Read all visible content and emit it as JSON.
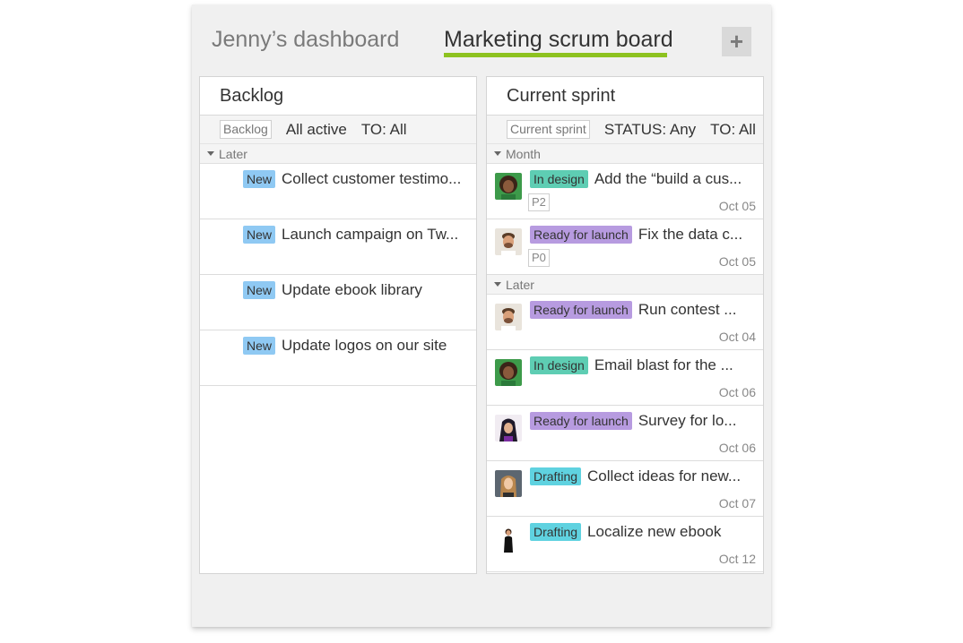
{
  "tabs": [
    {
      "label": "Jenny’s dashboard"
    },
    {
      "label": "Marketing scrum board"
    }
  ],
  "add_button": {
    "label": "+"
  },
  "backlog": {
    "title": "Backlog",
    "filters": {
      "chip": "Backlog",
      "status": "All active",
      "to": "TO: All"
    },
    "group": "Later",
    "tasks": [
      {
        "badge": "New",
        "title": "Collect customer testimo..."
      },
      {
        "badge": "New",
        "title": "Launch campaign on Tw..."
      },
      {
        "badge": "New",
        "title": "Update ebook library"
      },
      {
        "badge": "New",
        "title": "Update logos on our site"
      }
    ]
  },
  "sprint": {
    "title": "Current sprint",
    "filters": {
      "chip": "Current sprint",
      "status": "STATUS: Any",
      "to": "TO: All"
    },
    "groups": [
      {
        "label": "Month",
        "tasks": [
          {
            "badge": "In design",
            "title": "Add the “build a cus...",
            "priority": "P2",
            "date": "Oct 05",
            "avatar": "avatar-curly-green"
          },
          {
            "badge": "Ready for launch",
            "title": "Fix the data c...",
            "priority": "P0",
            "date": "Oct 05",
            "avatar": "avatar-man-beard"
          }
        ]
      },
      {
        "label": "Later",
        "tasks": [
          {
            "badge": "Ready for launch",
            "title": "Run contest ...",
            "date": "Oct 04",
            "avatar": "avatar-man-beard"
          },
          {
            "badge": "In design",
            "title": "Email blast for the ...",
            "date": "Oct 06",
            "avatar": "avatar-curly-green"
          },
          {
            "badge": "Ready for launch",
            "title": "Survey for lo...",
            "date": "Oct 06",
            "avatar": "avatar-woman-dark"
          },
          {
            "badge": "Drafting",
            "title": "Collect ideas for new...",
            "date": "Oct 07",
            "avatar": "avatar-woman-blonde"
          },
          {
            "badge": "Drafting",
            "title": "Localize new ebook",
            "date": "Oct 12",
            "avatar": "avatar-woman-standing"
          }
        ]
      }
    ]
  },
  "colors": {
    "tab_underline": "#8dc21f",
    "badge_new": "#8fc9f3",
    "badge_in_design": "#5ecdb3",
    "badge_ready_for_launch": "#b79be0",
    "badge_drafting": "#5fd2e0"
  }
}
